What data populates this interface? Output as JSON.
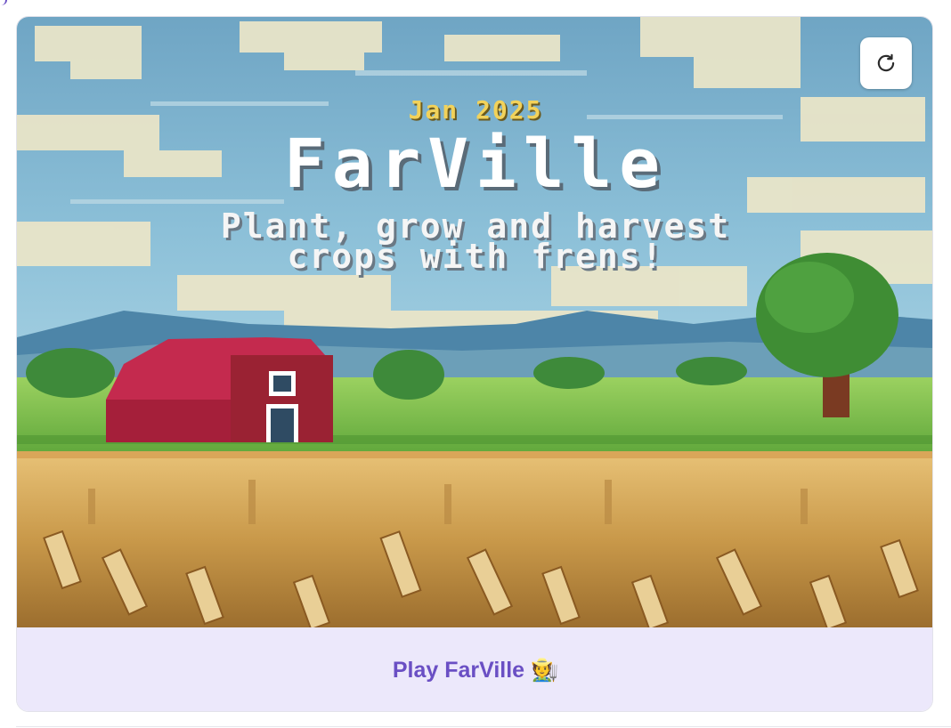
{
  "card": {
    "image": {
      "date": "Jan 2025",
      "title": "FarVille",
      "tagline": "Plant, grow and harvest\ncrops with frens!"
    },
    "refresh_button": {
      "icon": "refresh-icon"
    },
    "footer_button": {
      "label": "Play FarVille 🧑‍🌾"
    }
  },
  "colors": {
    "accent": "#6a4fc4",
    "footer_bg": "#ece8fb",
    "date_text": "#f2d25a"
  }
}
